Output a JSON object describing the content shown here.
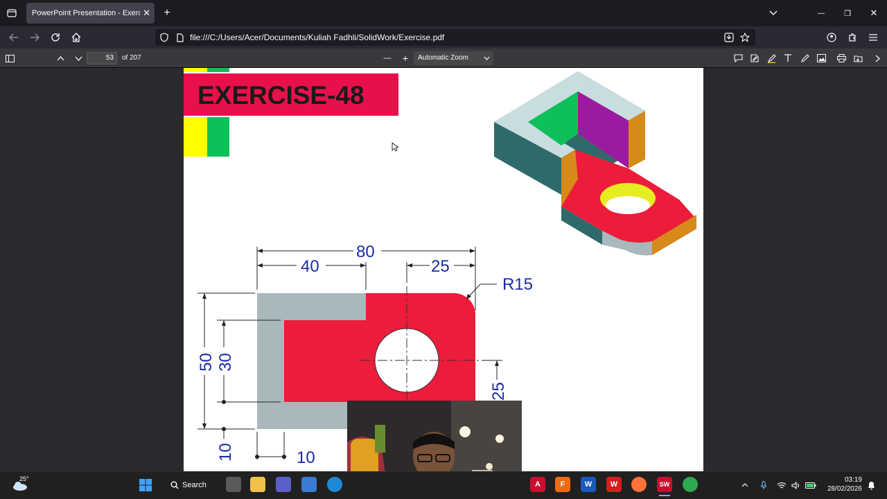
{
  "browser": {
    "tab_title": "PowerPoint Presentation - Exercise.pdf",
    "tab_close": "✕",
    "new_tab": "+",
    "url": "file:///C:/Users/Acer/Documents/Kuliah Fadhli/SolidWork/Exercise.pdf",
    "window_controls": [
      "—",
      "❐",
      "✕"
    ]
  },
  "pdf_toolbar": {
    "page_number": "53",
    "page_count": "of 207",
    "zoom": "Automatic Zoom",
    "zoom_minus": "—",
    "zoom_plus": "+"
  },
  "slide": {
    "title": "EXERCISE-48",
    "title_bg": "#e8104a",
    "dims": {
      "d80": "80",
      "d40": "40",
      "d25_top": "25",
      "r15": "R15",
      "d50": "50",
      "d30": "30",
      "d25_side": "25",
      "d10_left": "10",
      "d10_bottom": "10"
    }
  },
  "taskbar": {
    "weather": "25°",
    "search": "Search",
    "time": "03:19",
    "date": "28/02/2026"
  },
  "colors": {
    "red": "#ec1c3a",
    "gray": "#a8b8bc",
    "teal": "#2f6a6b",
    "green": "#0ec05a",
    "purple": "#9c1aa0",
    "orange": "#d68a1a",
    "yellow": "#ffff00",
    "dim_blue": "#1a2aa8"
  }
}
